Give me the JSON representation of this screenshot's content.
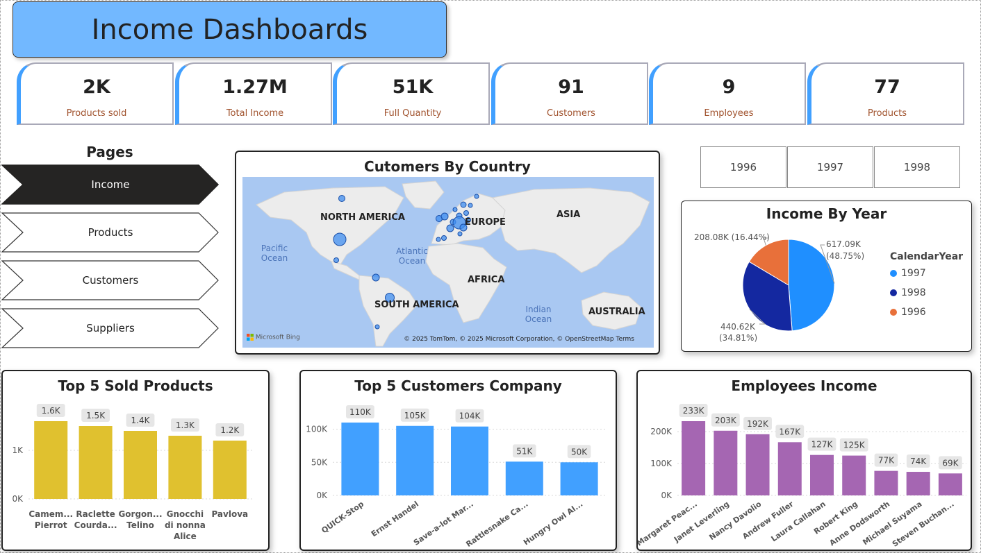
{
  "header": {
    "title": "Income Dashboards"
  },
  "kpis": [
    {
      "value": "2K",
      "label": "Products sold"
    },
    {
      "value": "1.27M",
      "label": "Total Income"
    },
    {
      "value": "51K",
      "label": "Full Quantity"
    },
    {
      "value": "91",
      "label": "Customers"
    },
    {
      "value": "9",
      "label": "Employees"
    },
    {
      "value": "77",
      "label": "Products"
    }
  ],
  "nav": {
    "title": "Pages",
    "items": [
      {
        "label": "Income",
        "active": true
      },
      {
        "label": "Products",
        "active": false
      },
      {
        "label": "Customers",
        "active": false
      },
      {
        "label": "Suppliers",
        "active": false
      }
    ]
  },
  "map": {
    "title": "Cutomers By Country",
    "continents": [
      "NORTH AMERICA",
      "EUROPE",
      "ASIA",
      "AFRICA",
      "SOUTH AMERICA",
      "AUSTRALIA"
    ],
    "oceans": [
      "Pacific Ocean",
      "Atlantic Ocean",
      "Indian Ocean"
    ],
    "provider": "Microsoft Bing",
    "attribution": "© 2025 TomTom, © 2025 Microsoft Corporation, © OpenStreetMap  Terms"
  },
  "year_slicer": [
    "1996",
    "1997",
    "1998"
  ],
  "colors": {
    "accent": "#41a0ff",
    "title_banner": "#72b8ff",
    "gold": "#e0c12f",
    "blue": "#41a0ff",
    "purple": "#a566b2",
    "pie_1997": "#1f8fff",
    "pie_1998": "#1428a0",
    "pie_1996": "#e8703a",
    "active_nav": "#252423"
  },
  "chart_data": [
    {
      "type": "pie",
      "title": "Income By Year",
      "legend_title": "CalendarYear",
      "legend_position": "right",
      "categories": [
        "1997",
        "1998",
        "1996"
      ],
      "values": [
        617090,
        440620,
        208080
      ],
      "labels": [
        "617.09K (48.75%)",
        "440.62K (34.81%)",
        "208.08K (16.44%)"
      ],
      "value_labels": [
        "617.09K",
        "440.62K",
        "208.08K (16.44%)"
      ],
      "percent_labels": [
        "(48.75%)",
        "(34.81%)",
        ""
      ]
    },
    {
      "type": "bar",
      "title": "Top 5 Sold Products",
      "categories": [
        "Camem... Pierrot",
        "Raclette Courda...",
        "Gorgon... Telino",
        "Gnocchi di nonna Alice",
        "Pavlova"
      ],
      "category_lines": [
        [
          "Camem...",
          "Pierrot"
        ],
        [
          "Raclette",
          "Courda..."
        ],
        [
          "Gorgon...",
          "Telino"
        ],
        [
          "Gnocchi",
          "di nonna",
          "Alice"
        ],
        [
          "Pavlova"
        ]
      ],
      "values": [
        1600,
        1500,
        1400,
        1300,
        1200
      ],
      "data_labels": [
        "1.6K",
        "1.5K",
        "1.4K",
        "1.3K",
        "1.2K"
      ],
      "yticks": [
        "0K",
        "1K"
      ],
      "ylim": [
        0,
        1600
      ],
      "grid": true
    },
    {
      "type": "bar",
      "title": "Top 5 Customers Company",
      "categories": [
        "QUICK-Stop",
        "Ernst Handel",
        "Save-a-lot Mar...",
        "Rattlesnake Ca...",
        "Hungry Owl Al..."
      ],
      "values": [
        110000,
        105000,
        104000,
        51000,
        50000
      ],
      "data_labels": [
        "110K",
        "105K",
        "104K",
        "51K",
        "50K"
      ],
      "yticks": [
        "0K",
        "50K",
        "100K"
      ],
      "ylim": [
        0,
        110000
      ],
      "grid": true
    },
    {
      "type": "bar",
      "title": "Employees Income",
      "categories": [
        "Margaret Peac...",
        "Janet Leverling",
        "Nancy Davolio",
        "Andrew Fuller",
        "Laura Callahan",
        "Robert King",
        "Anne Dodsworth",
        "Michael Suyama",
        "Steven Buchan..."
      ],
      "values": [
        233000,
        203000,
        192000,
        167000,
        127000,
        125000,
        77000,
        74000,
        69000
      ],
      "data_labels": [
        "233K",
        "203K",
        "192K",
        "167K",
        "127K",
        "125K",
        "77K",
        "74K",
        "69K"
      ],
      "yticks": [
        "0K",
        "100K",
        "200K"
      ],
      "ylim": [
        0,
        233000
      ],
      "grid": true
    }
  ]
}
